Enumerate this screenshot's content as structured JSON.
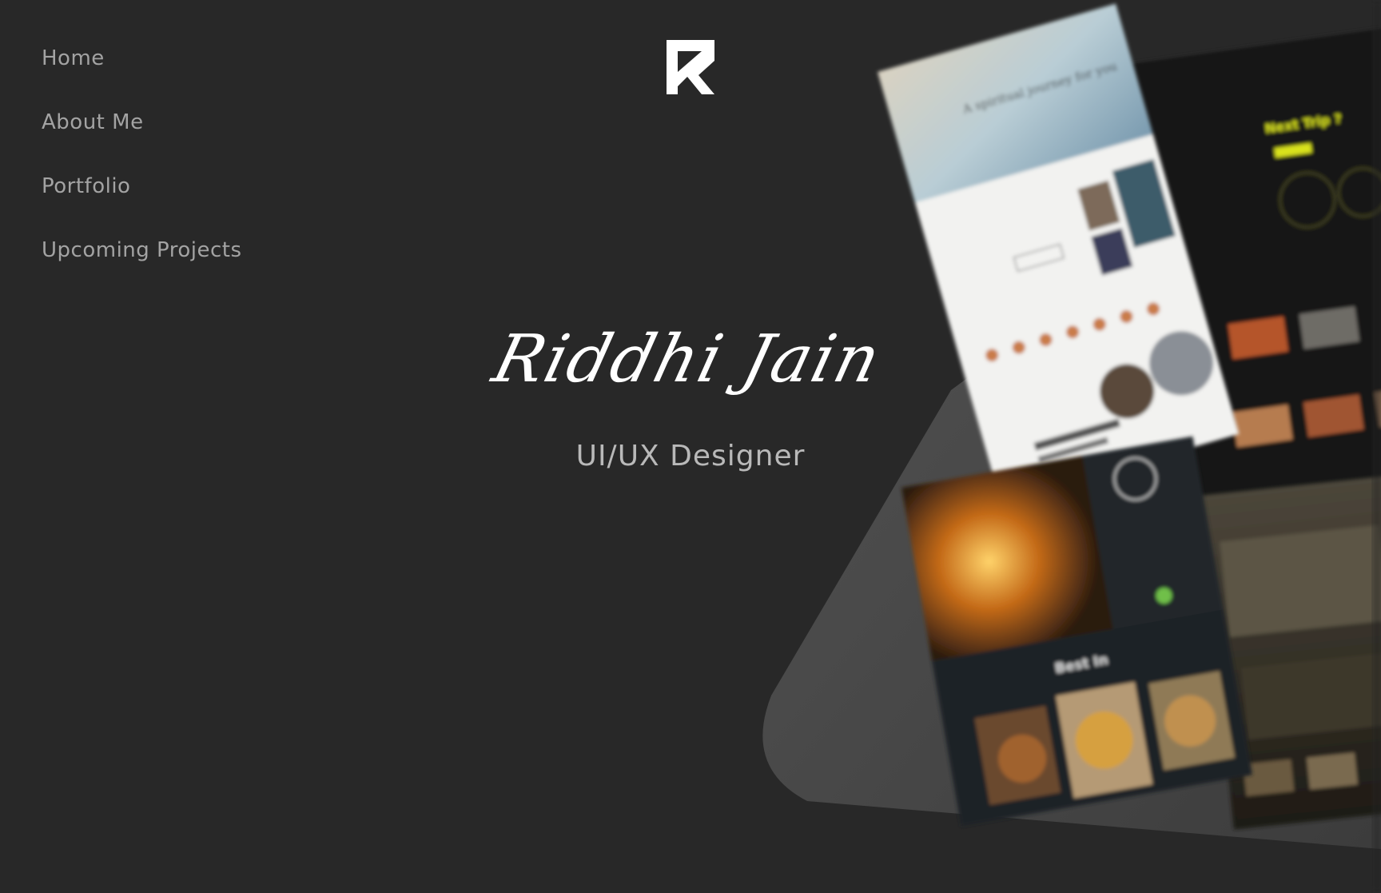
{
  "nav": {
    "items": [
      {
        "label": "Home"
      },
      {
        "label": "About Me"
      },
      {
        "label": "Portfolio"
      },
      {
        "label": "Upcoming Projects"
      }
    ]
  },
  "logo": {
    "icon": "rj-monogram-logo"
  },
  "hero": {
    "name": "Riddhi Jain",
    "role": "UI/UX Designer"
  },
  "showcase": {
    "left_mockup_heading": "A spiritual journey for you",
    "dark_mockup_heading": "Next Trip ?",
    "food_mockup_heading": "Best In"
  },
  "colors": {
    "background": "#282828",
    "nav_text": "#a3a3a3",
    "accent_yellow": "#d9e21f",
    "panel_gray": "#4a4a4a"
  }
}
